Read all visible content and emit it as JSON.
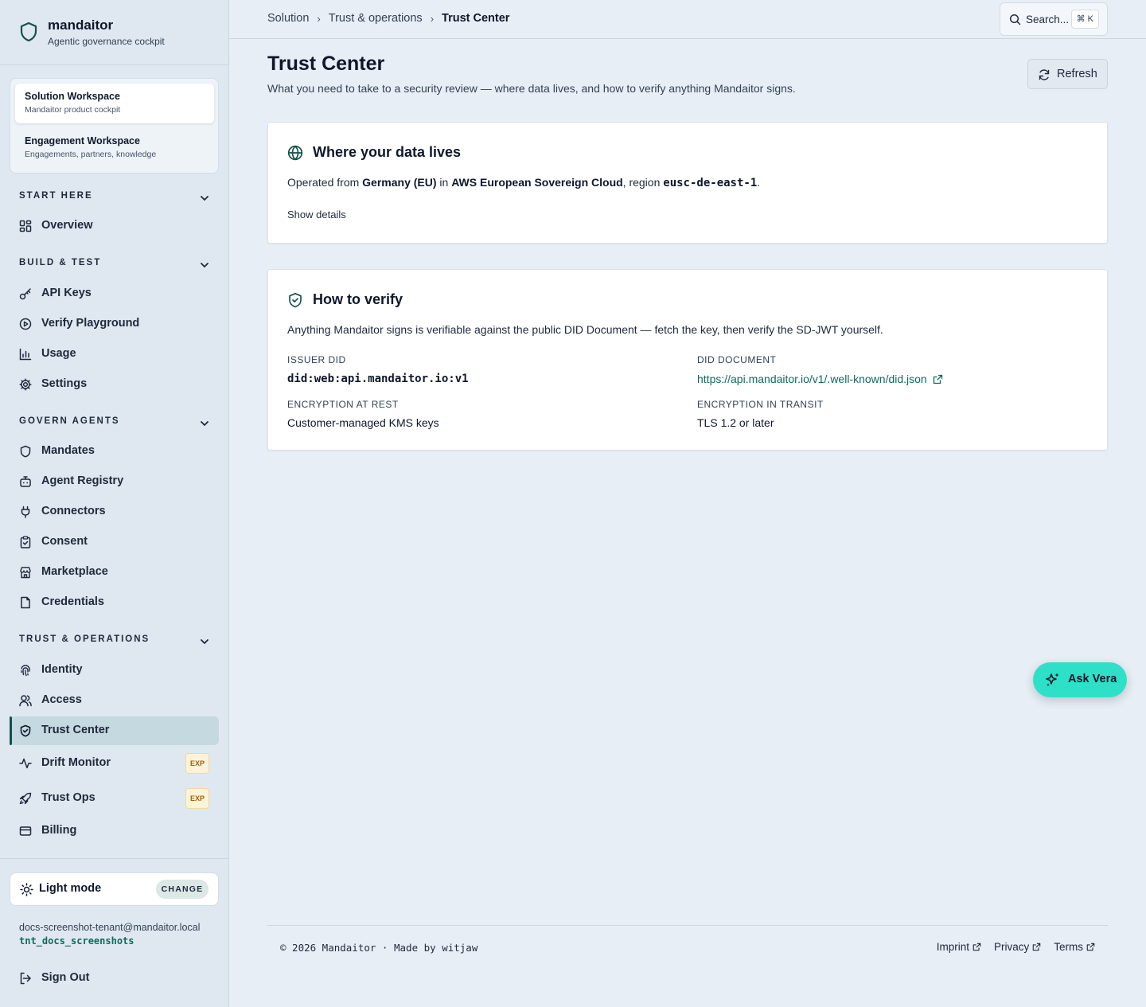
{
  "brand": {
    "name": "mandaitor",
    "tagline": "Agentic governance cockpit"
  },
  "workspaces": [
    {
      "title": "Solution Workspace",
      "subtitle": "Mandaitor product cockpit",
      "active": true
    },
    {
      "title": "Engagement Workspace",
      "subtitle": "Engagements, partners, knowledge",
      "active": false
    }
  ],
  "nav": {
    "start_here": {
      "title": "START HERE",
      "items": [
        "Overview"
      ]
    },
    "build_test": {
      "title": "BUILD & TEST",
      "items": [
        "API Keys",
        "Verify Playground",
        "Usage",
        "Settings"
      ]
    },
    "govern_agents": {
      "title": "GOVERN AGENTS",
      "items": [
        "Mandates",
        "Agent Registry",
        "Connectors",
        "Consent",
        "Marketplace",
        "Credentials"
      ]
    },
    "trust_ops": {
      "title": "TRUST & OPERATIONS",
      "items": [
        "Identity",
        "Access",
        "Trust Center",
        "Drift Monitor",
        "Trust Ops",
        "Billing"
      ]
    },
    "exp_badge": "EXP",
    "active_item": "Trust Center"
  },
  "theme": {
    "label": "Light mode",
    "change_label": "CHANGE"
  },
  "tenant": {
    "email": "docs-screenshot-tenant@mandaitor.local",
    "id": "tnt_docs_screenshots"
  },
  "sign_out": "Sign Out",
  "breadcrumb": [
    "Solution",
    "Trust & operations",
    "Trust Center"
  ],
  "search": {
    "label": "Search...",
    "shortcut": "⌘ K"
  },
  "page": {
    "title": "Trust Center",
    "subtitle": "What you need to take to a security review — where data lives, and how to verify anything Mandaitor signs.",
    "refresh_label": "Refresh"
  },
  "data_card": {
    "title": "Where your data lives",
    "operated_from": "Operated from ",
    "country": "Germany (EU)",
    "in": " in ",
    "cloud": "AWS European Sovereign Cloud",
    "region_prefix": ", region ",
    "region": "eusc-de-east-1",
    "period": ".",
    "show_details": "Show details"
  },
  "verify_card": {
    "title": "How to verify",
    "description": "Anything Mandaitor signs is verifiable against the public DID Document — fetch the key, then verify the SD-JWT yourself.",
    "issuer_did_label": "ISSUER DID",
    "issuer_did": "did:web:api.mandaitor.io:v1",
    "did_document_label": "DID DOCUMENT",
    "did_document_url": "https://api.mandaitor.io/v1/.well-known/did.json",
    "encryption_rest_label": "ENCRYPTION AT REST",
    "encryption_rest": "Customer-managed KMS keys",
    "encryption_transit_label": "ENCRYPTION IN TRANSIT",
    "encryption_transit": "TLS 1.2 or later"
  },
  "ask_vera": "Ask Vera",
  "footer": {
    "copyright": "© 2026 Mandaitor · Made by witjaw",
    "links": [
      "Imprint",
      "Privacy",
      "Terms"
    ]
  },
  "colors": {
    "accent": "#0f6b5c",
    "ask_vera_bg": "#2ee0c8",
    "active_nav_bg": "#c5d9e0",
    "exp_badge_bg": "#fdf3d6"
  }
}
